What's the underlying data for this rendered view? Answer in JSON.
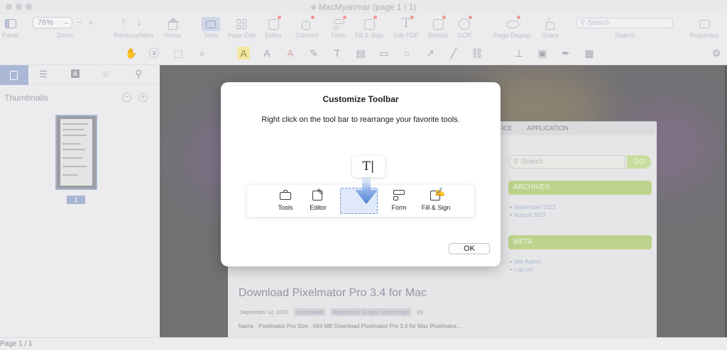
{
  "window": {
    "title": "MacMyanmar (page 1 / 1)"
  },
  "toolbar": {
    "zoom_value": "76%",
    "zoom_label": "Zoom",
    "panel_label": "Panel",
    "prev_next_label": "Previous/Next",
    "home_label": "Home",
    "tools_label": "Tools",
    "page_edit_label": "Page Edit",
    "editor_label": "Editor",
    "convert_label": "Convert",
    "form_label": "Form",
    "fill_sign_label": "Fill & Sign",
    "edit_pdf_label": "Edit PDF",
    "redact_label": "Redact",
    "ocr_label": "OCR",
    "page_display_label": "Page Display",
    "share_label": "Share",
    "search_placeholder": "Search",
    "search_label": "Search",
    "properties_label": "Properties"
  },
  "sidebar": {
    "thumbnails_label": "Thumbnails",
    "page_number": "1"
  },
  "document": {
    "nav_items": [
      "FICE",
      "APPLICATION"
    ],
    "search_placeholder": "Search",
    "go_label": "GO",
    "archives_label": "ARCHIVES",
    "archive_links": [
      "September 2023",
      "August 2023"
    ],
    "meta_label": "META",
    "meta_links": [
      "Site Admin",
      "Log out"
    ],
    "post_title": "Download Pixelmator Pro 3.4 for Mac",
    "post_date": "September 12, 2023",
    "post_author": "Jameskake",
    "post_categories": "Application, Graphic and Design",
    "post_comments": "(0)",
    "post_excerpt": "Name : Pixelmator Pro Size : 594 MB Download Pixelmator Pro 3.4 for Mac Pixelmator..."
  },
  "status": {
    "page_indicator": "Page 1 / 1"
  },
  "dialog": {
    "title": "Customize Toolbar",
    "message": "Right click on the tool bar to rearrange your favorite tools.",
    "drag_glyph": "T|",
    "items": [
      {
        "label": "Tools",
        "icon": "toolbox-icon"
      },
      {
        "label": "Editor",
        "icon": "edit-icon"
      },
      {
        "label": "Form",
        "icon": "form-icon"
      },
      {
        "label": "Fill & Sign",
        "icon": "fill-sign-icon"
      }
    ],
    "ok_label": "OK"
  }
}
